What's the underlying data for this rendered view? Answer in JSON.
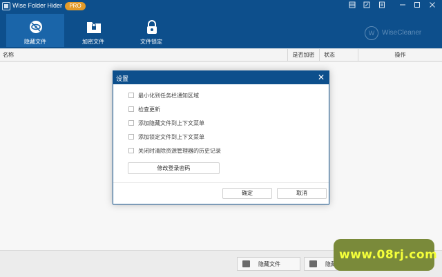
{
  "app": {
    "title": "Wise Folder Hider",
    "badge": "PRO",
    "brand": "WiseCleaner",
    "brand_logo": "W"
  },
  "window_controls": [
    "menu-icon",
    "feedback-icon",
    "skin-icon",
    "minimize-icon",
    "maximize-icon",
    "close-icon"
  ],
  "toolbar": {
    "tabs": [
      {
        "label": "隐藏文件",
        "icon": "eye-slash-icon",
        "active": true
      },
      {
        "label": "加密文件",
        "icon": "lock-folder-icon",
        "active": false
      },
      {
        "label": "文件锁定",
        "icon": "padlock-icon",
        "active": false
      }
    ]
  },
  "table": {
    "columns": [
      "名称",
      "是否加密",
      "状态",
      "操作"
    ]
  },
  "dialog": {
    "title": "设置",
    "options": [
      {
        "label": "最小化到任务栏通知区域",
        "checked": false
      },
      {
        "label": "检查更新",
        "checked": false
      },
      {
        "label": "添加隐藏文件到上下文菜单",
        "checked": false
      },
      {
        "label": "添加锁定文件到上下文菜单",
        "checked": false
      },
      {
        "label": "关闭时清除资源管理器的历史记录",
        "checked": false
      }
    ],
    "change_password": "修改登录密码",
    "ok": "确定",
    "cancel": "取消"
  },
  "bottom": {
    "hide_file": "隐藏文件",
    "hide_folder": "隐藏"
  },
  "watermark": "www.08rj.com",
  "colors": {
    "titlebar": "#0d4f8c",
    "active_tab": "#1a65a9",
    "badge": "#e29b2a"
  }
}
